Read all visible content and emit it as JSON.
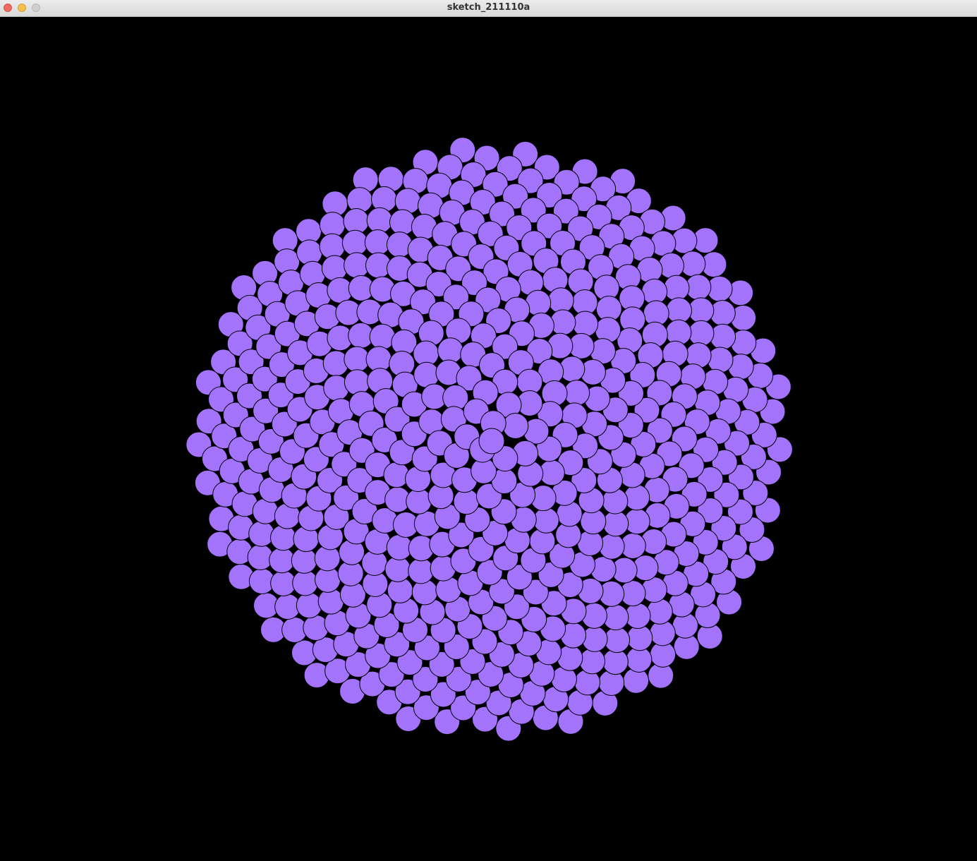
{
  "window": {
    "title": "sketch_211110a",
    "buttons": {
      "close": "close-icon",
      "minimize": "minimize-icon",
      "zoom": "zoom-icon"
    }
  },
  "sketch": {
    "background_color": "#000000",
    "dot_color": "#a374fb",
    "dot_stroke_color": "#000000",
    "pattern": "phyllotaxis",
    "dot_count": 540,
    "golden_angle_deg": 137.508
  }
}
